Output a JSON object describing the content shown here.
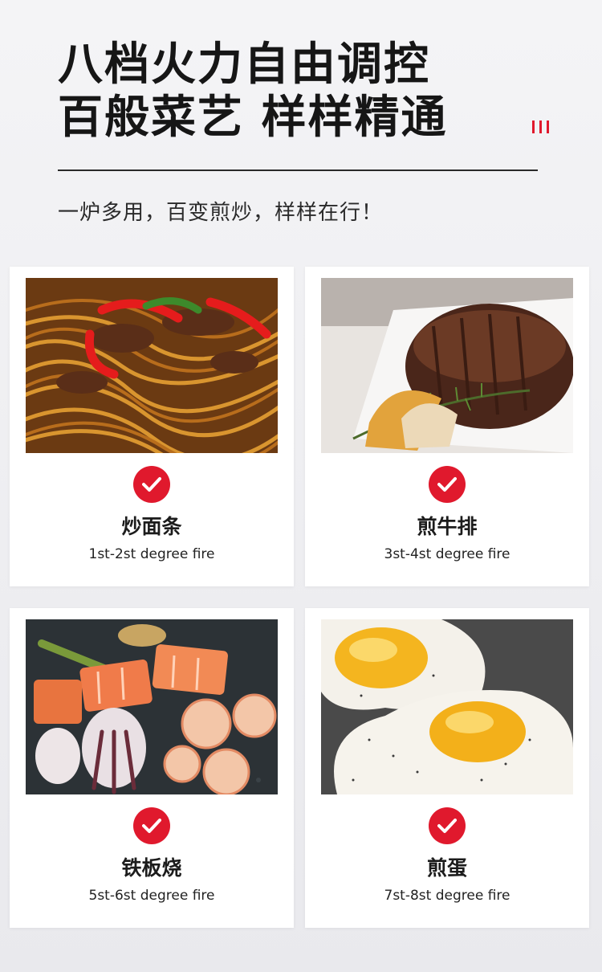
{
  "header": {
    "title_line1": "八档火力自由调控",
    "title_line2": "百般菜艺 样样精通",
    "subtitle": "一炉多用，百变煎炒，样样在行！"
  },
  "colors": {
    "accent": "#e0192d",
    "card": "#ffffff",
    "background": "#f0f0f3"
  },
  "cards": [
    {
      "dish": "炒面条",
      "fire": "1st-2st degree fire",
      "photo": "stir-fried-noodles-photo"
    },
    {
      "dish": "煎牛排",
      "fire": "3st-4st degree fire",
      "photo": "steak-photo"
    },
    {
      "dish": "铁板烧",
      "fire": "5st-6st degree fire",
      "photo": "teppanyaki-seafood-photo"
    },
    {
      "dish": "煎蛋",
      "fire": "7st-8st degree fire",
      "photo": "fried-eggs-photo"
    }
  ]
}
